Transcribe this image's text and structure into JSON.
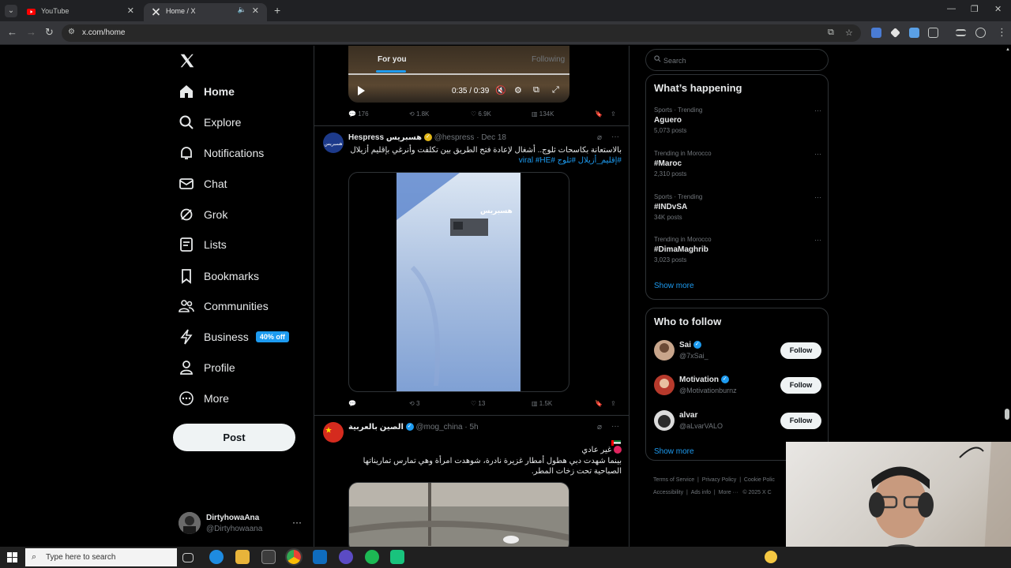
{
  "browser": {
    "tabs": [
      {
        "title": "YouTube",
        "active": false
      },
      {
        "title": "Home / X",
        "active": true
      }
    ],
    "url": "x.com/home"
  },
  "nav": {
    "items": [
      {
        "label": "Home",
        "icon": "home-icon"
      },
      {
        "label": "Explore",
        "icon": "search-icon"
      },
      {
        "label": "Notifications",
        "icon": "bell-icon"
      },
      {
        "label": "Chat",
        "icon": "mail-icon"
      },
      {
        "label": "Grok",
        "icon": "grok-icon"
      },
      {
        "label": "Lists",
        "icon": "list-icon"
      },
      {
        "label": "Bookmarks",
        "icon": "bookmark-icon"
      },
      {
        "label": "Communities",
        "icon": "people-icon"
      },
      {
        "label": "Business",
        "icon": "lightning-icon"
      },
      {
        "label": "Profile",
        "icon": "person-icon"
      },
      {
        "label": "More",
        "icon": "more-circle-icon"
      }
    ],
    "business_badge": "40% off",
    "post_label": "Post"
  },
  "account": {
    "name": "DirtyhowaAna",
    "handle": "@Dirtyhowaana"
  },
  "feed": {
    "tabs": {
      "for_you": "For you",
      "following": "Following"
    },
    "video": {
      "time": "0:35 / 0:39"
    },
    "first_actions": {
      "replies": "176",
      "reposts": "1.8K",
      "likes": "6.9K",
      "views": "134K"
    },
    "tweets": [
      {
        "name": "Hespress هسبريس",
        "handle": "@hespress",
        "time": "Dec 18",
        "text": "بالاستعانة بكاسحات ثلوج.. أشغال لإعادة فتح الطريق بين تكلفت وأنرغي بإقليم أزيلال",
        "hashtags": "#إقليم_أزيلال #ثلوج #viral #HE",
        "watermark": "هسبريس",
        "actions": {
          "replies": "",
          "reposts": "3",
          "likes": "13",
          "views": "1.5K"
        }
      },
      {
        "name": "الصين بالعربية",
        "handle": "@mog_china",
        "time": "5h",
        "line1": "غير عادي",
        "text": "بينما شهدت دبي هطول أمطار غزيرة نادرة، شوهدت امرأة وهي تمارس تماريناتها الصباحية تحت زخات المطر."
      }
    ]
  },
  "search": {
    "placeholder": "Search"
  },
  "trending": {
    "title": "What’s happening",
    "items": [
      {
        "context": "Sports · Trending",
        "name": "Aguero",
        "count": "5,073 posts"
      },
      {
        "context": "Trending in Morocco",
        "name": "#Maroc",
        "count": "2,310 posts"
      },
      {
        "context": "Sports · Trending",
        "name": "#INDvSA",
        "count": "34K posts"
      },
      {
        "context": "Trending in Morocco",
        "name": "#DimaMaghrib",
        "count": "3,023 posts"
      }
    ],
    "show_more": "Show more"
  },
  "who_to_follow": {
    "title": "Who to follow",
    "items": [
      {
        "name": "Sai",
        "handle": "@7xSai_",
        "follow": "Follow"
      },
      {
        "name": "Motivation",
        "handle": "@Motivationburnz",
        "follow": "Follow"
      },
      {
        "name": "alvar",
        "handle": "@aLvarVALO",
        "follow": "Follow"
      }
    ],
    "show_more": "Show more"
  },
  "footer": {
    "terms": "Terms of Service",
    "privacy": "Privacy Policy",
    "cookie": "Cookie Polic",
    "accessibility": "Accessibility",
    "ads": "Ads info",
    "more": "More ···",
    "copyright": "© 2025 X C"
  },
  "taskbar": {
    "search_placeholder": "Type here to search"
  },
  "colors": {
    "accent": "#1d9bf0",
    "background": "#000000",
    "border": "#2f3336",
    "muted": "#71767b"
  }
}
